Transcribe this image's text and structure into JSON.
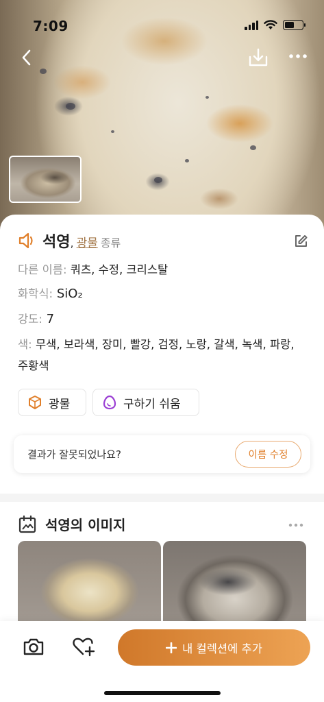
{
  "status_bar": {
    "time": "7:09"
  },
  "mineral": {
    "name": "석영",
    "name_separator": ",",
    "category": "광물",
    "category_suffix": "종류",
    "aliases_label": "다른 이름:",
    "aliases": "쿼츠, 수정, 크리스탈",
    "formula_label": "화학식:",
    "formula": "SiO₂",
    "hardness_label": "강도:",
    "hardness": "7",
    "color_label": "색:",
    "colors": "무색, 보라색, 장미, 빨강, 검정, 노랑, 갈색, 녹색, 파랑, 주황색"
  },
  "chips": [
    {
      "label": "광물",
      "icon": "gem-icon"
    },
    {
      "label": "구하기 쉬움",
      "icon": "egg-icon"
    }
  ],
  "feedback": {
    "question": "결과가 잘못되었나요?",
    "button": "이름 수정"
  },
  "images_section": {
    "title": "석영의 이미지"
  },
  "bottom_bar": {
    "add_button": "내 컬렉션에 추가"
  },
  "colors": {
    "accent": "#E07F2A",
    "link": "#A4784A",
    "chip_purple": "#9B3FD4"
  }
}
